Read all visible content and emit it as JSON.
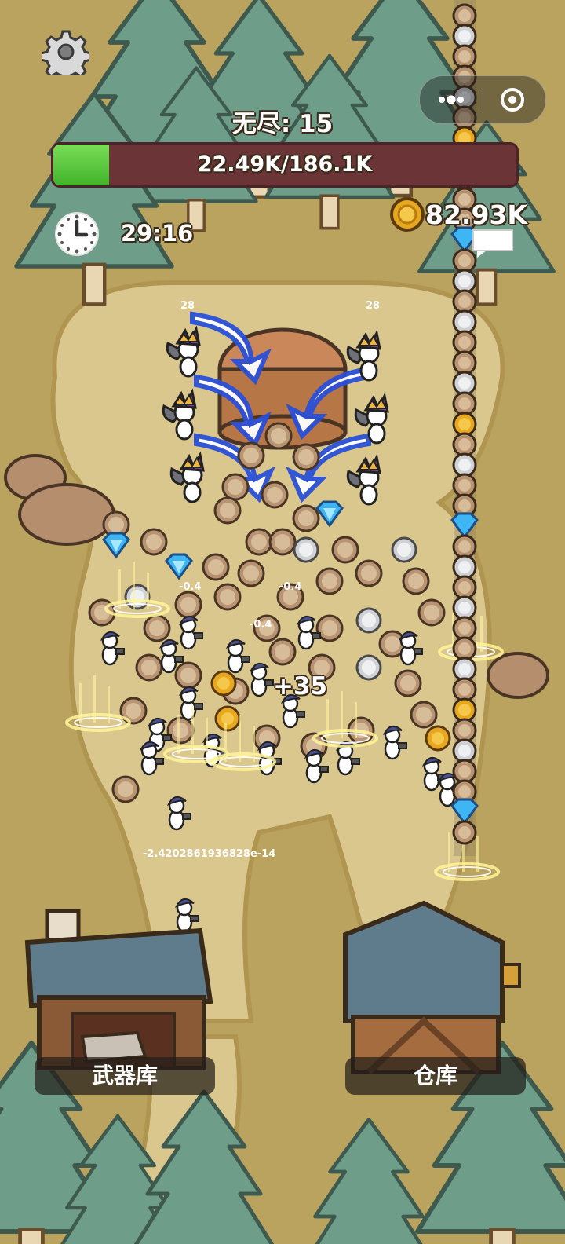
{
  "hud": {
    "mode_title": "无尽: 15",
    "hp_text": "22.49K/186.1K",
    "hp_fraction": 0.121,
    "timer": "29:16",
    "coins": "82.93K",
    "settings_icon": "gear-icon",
    "clock_icon": "clock-icon",
    "coin_icon": "coin-icon",
    "chat_icon": "chat-bubble-icon"
  },
  "capsule": {
    "more_icon": "more-dots-icon",
    "close_icon": "record-close-icon"
  },
  "battle": {
    "floating_gain": "+35",
    "damage_small": "-0.4",
    "enemy_hp_label": "28",
    "long_number": "-2.4202861936828e-14"
  },
  "buildings": {
    "armory_label": "武器库",
    "warehouse_label": "仓库"
  },
  "colors": {
    "ground": "#b9a35e",
    "path": "#d9c78e",
    "tree": "#6e9e8a",
    "hp_fill": "#4cc134",
    "hp_bg": "#6b3436"
  }
}
